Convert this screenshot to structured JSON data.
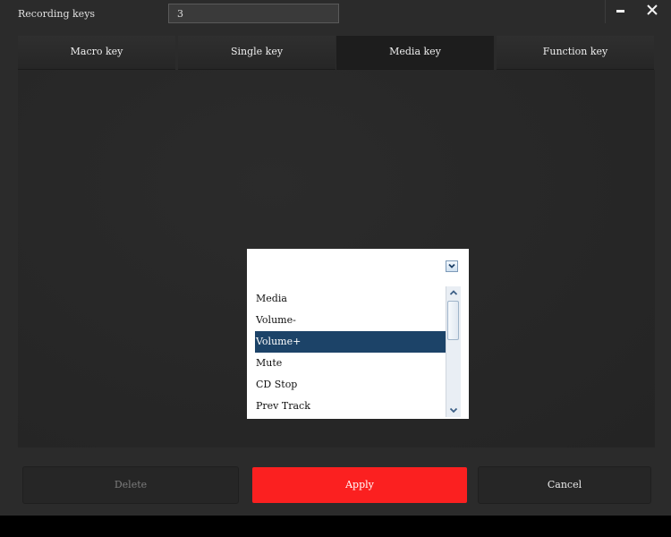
{
  "titlebar": {
    "label": "Recording keys",
    "input_value": "3"
  },
  "tabs": [
    {
      "label": "Macro key",
      "active": false
    },
    {
      "label": "Single key",
      "active": false
    },
    {
      "label": "Media key",
      "active": true
    },
    {
      "label": "Function key",
      "active": false
    }
  ],
  "dropdown": {
    "selected_value": "",
    "options": [
      "Media",
      "Volume-",
      "Volume+",
      "Mute",
      "CD Stop",
      "Prev Track"
    ],
    "highlighted_option": "Volume+"
  },
  "buttons": {
    "delete": "Delete",
    "apply": "Apply",
    "cancel": "Cancel"
  },
  "colors": {
    "background": "#2b2b2b",
    "accent_red": "#fb2020",
    "selection_blue": "#1c4368"
  }
}
